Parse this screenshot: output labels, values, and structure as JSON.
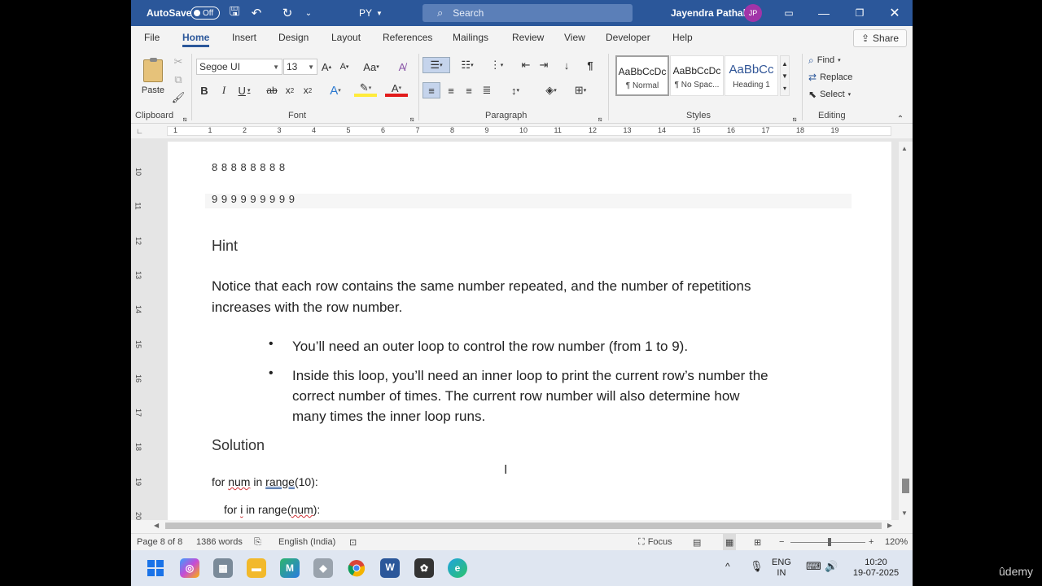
{
  "titlebar": {
    "autosave_label": "AutoSave",
    "autosave_state": "Off",
    "doc_title": "PY",
    "search_placeholder": "Search",
    "user_name": "Jayendra Pathak",
    "user_initials": "JP"
  },
  "tabs": [
    "File",
    "Home",
    "Insert",
    "Design",
    "Layout",
    "References",
    "Mailings",
    "Review",
    "View",
    "Developer",
    "Help"
  ],
  "active_tab": "Home",
  "share_label": "Share",
  "ribbon": {
    "clipboard": {
      "paste_label": "Paste",
      "group_label": "Clipboard"
    },
    "font": {
      "family": "Segoe UI",
      "size": "13",
      "group_label": "Font"
    },
    "paragraph": {
      "group_label": "Paragraph"
    },
    "styles": {
      "group_label": "Styles",
      "items": [
        {
          "preview": "AaBbCcDc",
          "name": "¶ Normal"
        },
        {
          "preview": "AaBbCcDc",
          "name": "¶ No Spac..."
        },
        {
          "preview": "AaBbCc",
          "name": "Heading 1"
        }
      ]
    },
    "editing": {
      "group_label": "Editing",
      "find": "Find",
      "replace": "Replace",
      "select": "Select"
    }
  },
  "ruler": {
    "h_numbers": [
      "1",
      "1",
      "2",
      "3",
      "4",
      "5",
      "6",
      "7",
      "8",
      "9",
      "10",
      "11",
      "12",
      "13",
      "14",
      "15",
      "16",
      "17",
      "18",
      "19"
    ],
    "v_numbers": [
      "10",
      "11",
      "12",
      "13",
      "14",
      "15",
      "16",
      "17",
      "18",
      "19",
      "20"
    ]
  },
  "document": {
    "pattern_rows": [
      "8  8  8  8  8  8  8  8",
      "9  9  9  9  9  9  9  9  9"
    ],
    "hint_heading": "Hint",
    "hint_para_1": "Notice that each row contains the same number repeated, and the number of repetitions",
    "hint_para_2": "increases with the row number.",
    "bullets": [
      {
        "lines": [
          "You’ll need an outer loop to control the row number (from 1 to 9)."
        ]
      },
      {
        "lines": [
          "Inside this loop, you’ll need an inner loop to print the current row’s number the",
          "correct number of times. The current row number will also determine how",
          "many times the inner loop runs."
        ]
      }
    ],
    "solution_heading": "Solution",
    "code": {
      "line1_a": "for ",
      "line1_b": "num",
      "line1_c": " in ",
      "line1_d": "range",
      "line1_e": "(10):",
      "line2_a": "for ",
      "line2_b": "i",
      "line2_c": " in range(",
      "line2_d": "num",
      "line2_e": "):"
    }
  },
  "statusbar": {
    "page": "Page 8 of 8",
    "words": "1386 words",
    "language": "English (India)",
    "focus": "Focus",
    "zoom": "120%"
  },
  "taskbar": {
    "lang_line1": "ENG",
    "lang_line2": "IN",
    "time": "10:20",
    "date": "19-07-2025"
  },
  "watermark": "ûdemy"
}
